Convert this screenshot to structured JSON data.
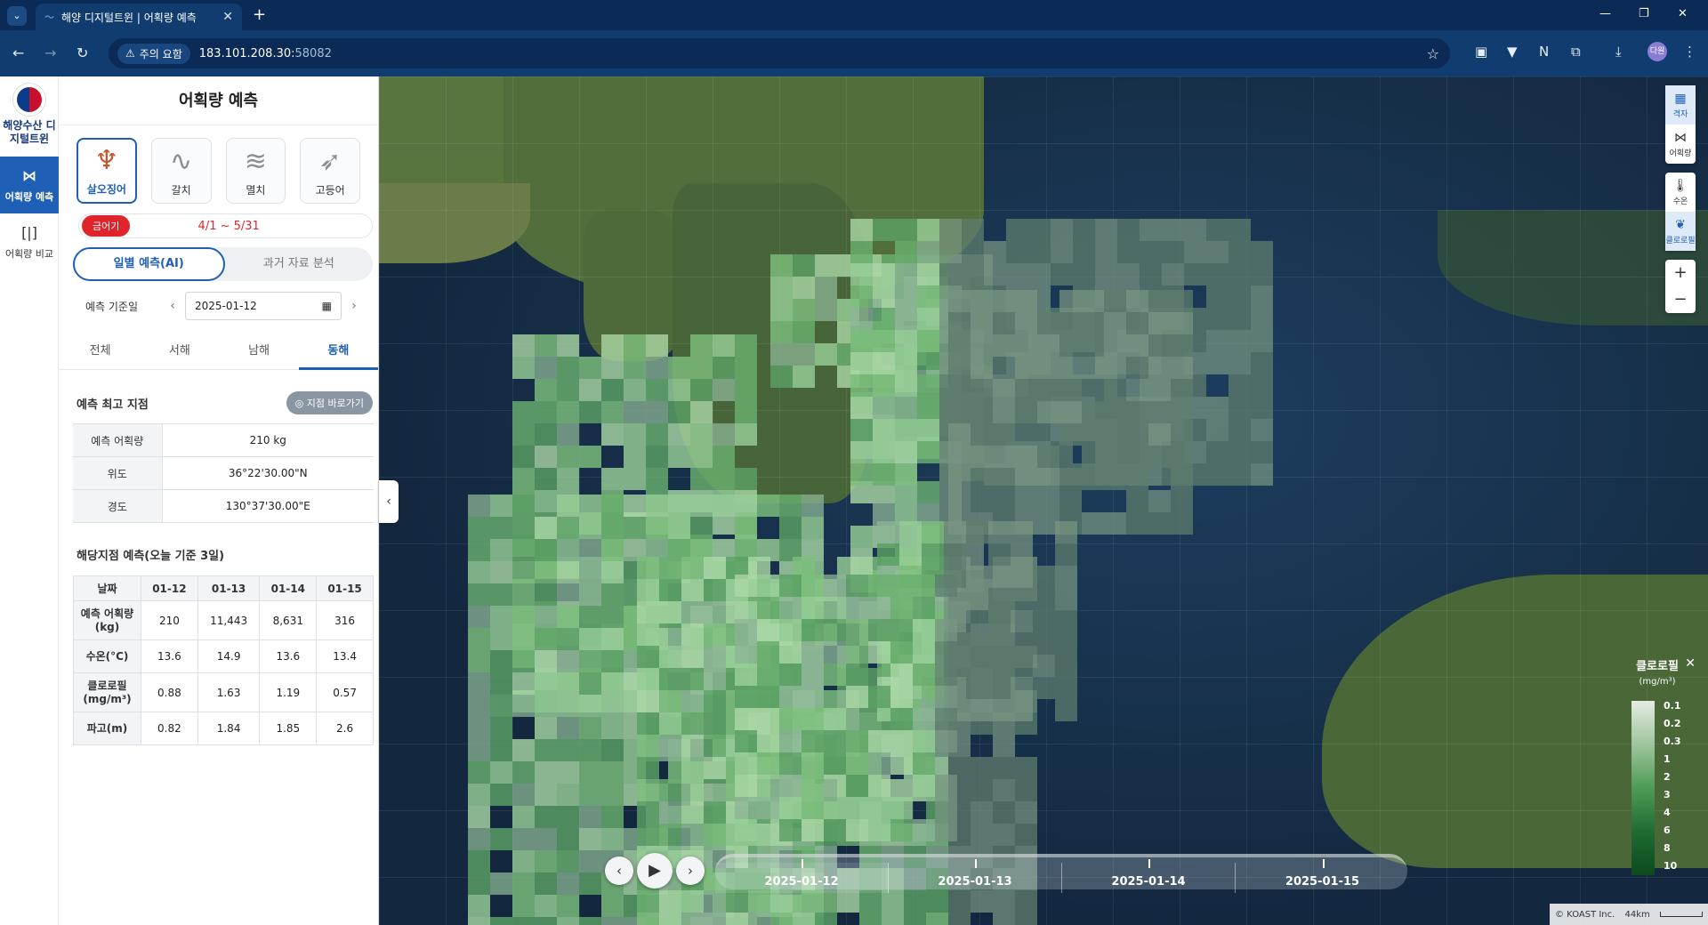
{
  "browser": {
    "tab_title": "해양 디지털트윈 | 어획량 예측",
    "warning_label": "주의 요함",
    "url_host": "183.101.208.30:",
    "url_port": "58082",
    "profile_label": "다원"
  },
  "rail": {
    "logo_text": "해양수산 디지털트윈",
    "items": [
      {
        "label": "어획량 예측",
        "active": true
      },
      {
        "label": "어획량 비교",
        "active": false
      }
    ]
  },
  "panel": {
    "title": "어획량 예측",
    "species": [
      {
        "label": "살오징어",
        "active": true
      },
      {
        "label": "갈치",
        "active": false
      },
      {
        "label": "멸치",
        "active": false
      },
      {
        "label": "고등어",
        "active": false
      }
    ],
    "season_badge": "금어기",
    "season_period": "4/1 ~ 5/31",
    "modes": [
      {
        "label": "일별 예측(AI)",
        "active": true
      },
      {
        "label": "과거 자료 분석",
        "active": false
      }
    ],
    "date_label": "예측 기준일",
    "date_value": "2025-01-12",
    "regions": [
      {
        "label": "전체",
        "active": false
      },
      {
        "label": "서해",
        "active": false
      },
      {
        "label": "남해",
        "active": false
      },
      {
        "label": "동해",
        "active": true
      }
    ],
    "top_point": {
      "title": "예측 최고 지점",
      "goto_label": "지점 바로가기",
      "rows": [
        {
          "k": "예측 어획량",
          "v": "210 kg"
        },
        {
          "k": "위도",
          "v": "36°22'30.00\"N"
        },
        {
          "k": "경도",
          "v": "130°37'30.00\"E"
        }
      ]
    },
    "forecast": {
      "title": "해당지점 예측(오늘 기준 3일)",
      "header": [
        "날짜",
        "01-12",
        "01-13",
        "01-14",
        "01-15"
      ],
      "rows": [
        {
          "label": "예측 어획량 (kg)",
          "values": [
            "210",
            "11,443",
            "8,631",
            "316"
          ]
        },
        {
          "label": "수온(°C)",
          "values": [
            "13.6",
            "14.9",
            "13.6",
            "13.4"
          ]
        },
        {
          "label": "클로로필 (mg/m³)",
          "values": [
            "0.88",
            "1.63",
            "1.19",
            "0.57"
          ]
        },
        {
          "label": "파고(m)",
          "values": [
            "0.82",
            "1.84",
            "1.85",
            "2.6"
          ]
        }
      ]
    }
  },
  "map": {
    "controls": [
      {
        "label": "격자",
        "icon": "grid-icon",
        "on": true
      },
      {
        "label": "어획량",
        "icon": "fish-icon",
        "on": false
      },
      {
        "label": "수온",
        "icon": "thermometer-icon",
        "on": false
      },
      {
        "label": "클로로필",
        "icon": "leaf-icon",
        "on": true
      }
    ],
    "legend": {
      "title": "클로로필",
      "unit": "(mg/m³)",
      "ticks": [
        "0.1",
        "0.2",
        "0.3",
        "1",
        "2",
        "3",
        "4",
        "6",
        "8",
        "10"
      ]
    },
    "timeline": [
      "2025-01-12",
      "2025-01-13",
      "2025-01-14",
      "2025-01-15"
    ],
    "timeline_active_index": 0,
    "attribution": "© KOAST Inc.",
    "scale_label": "44km"
  }
}
